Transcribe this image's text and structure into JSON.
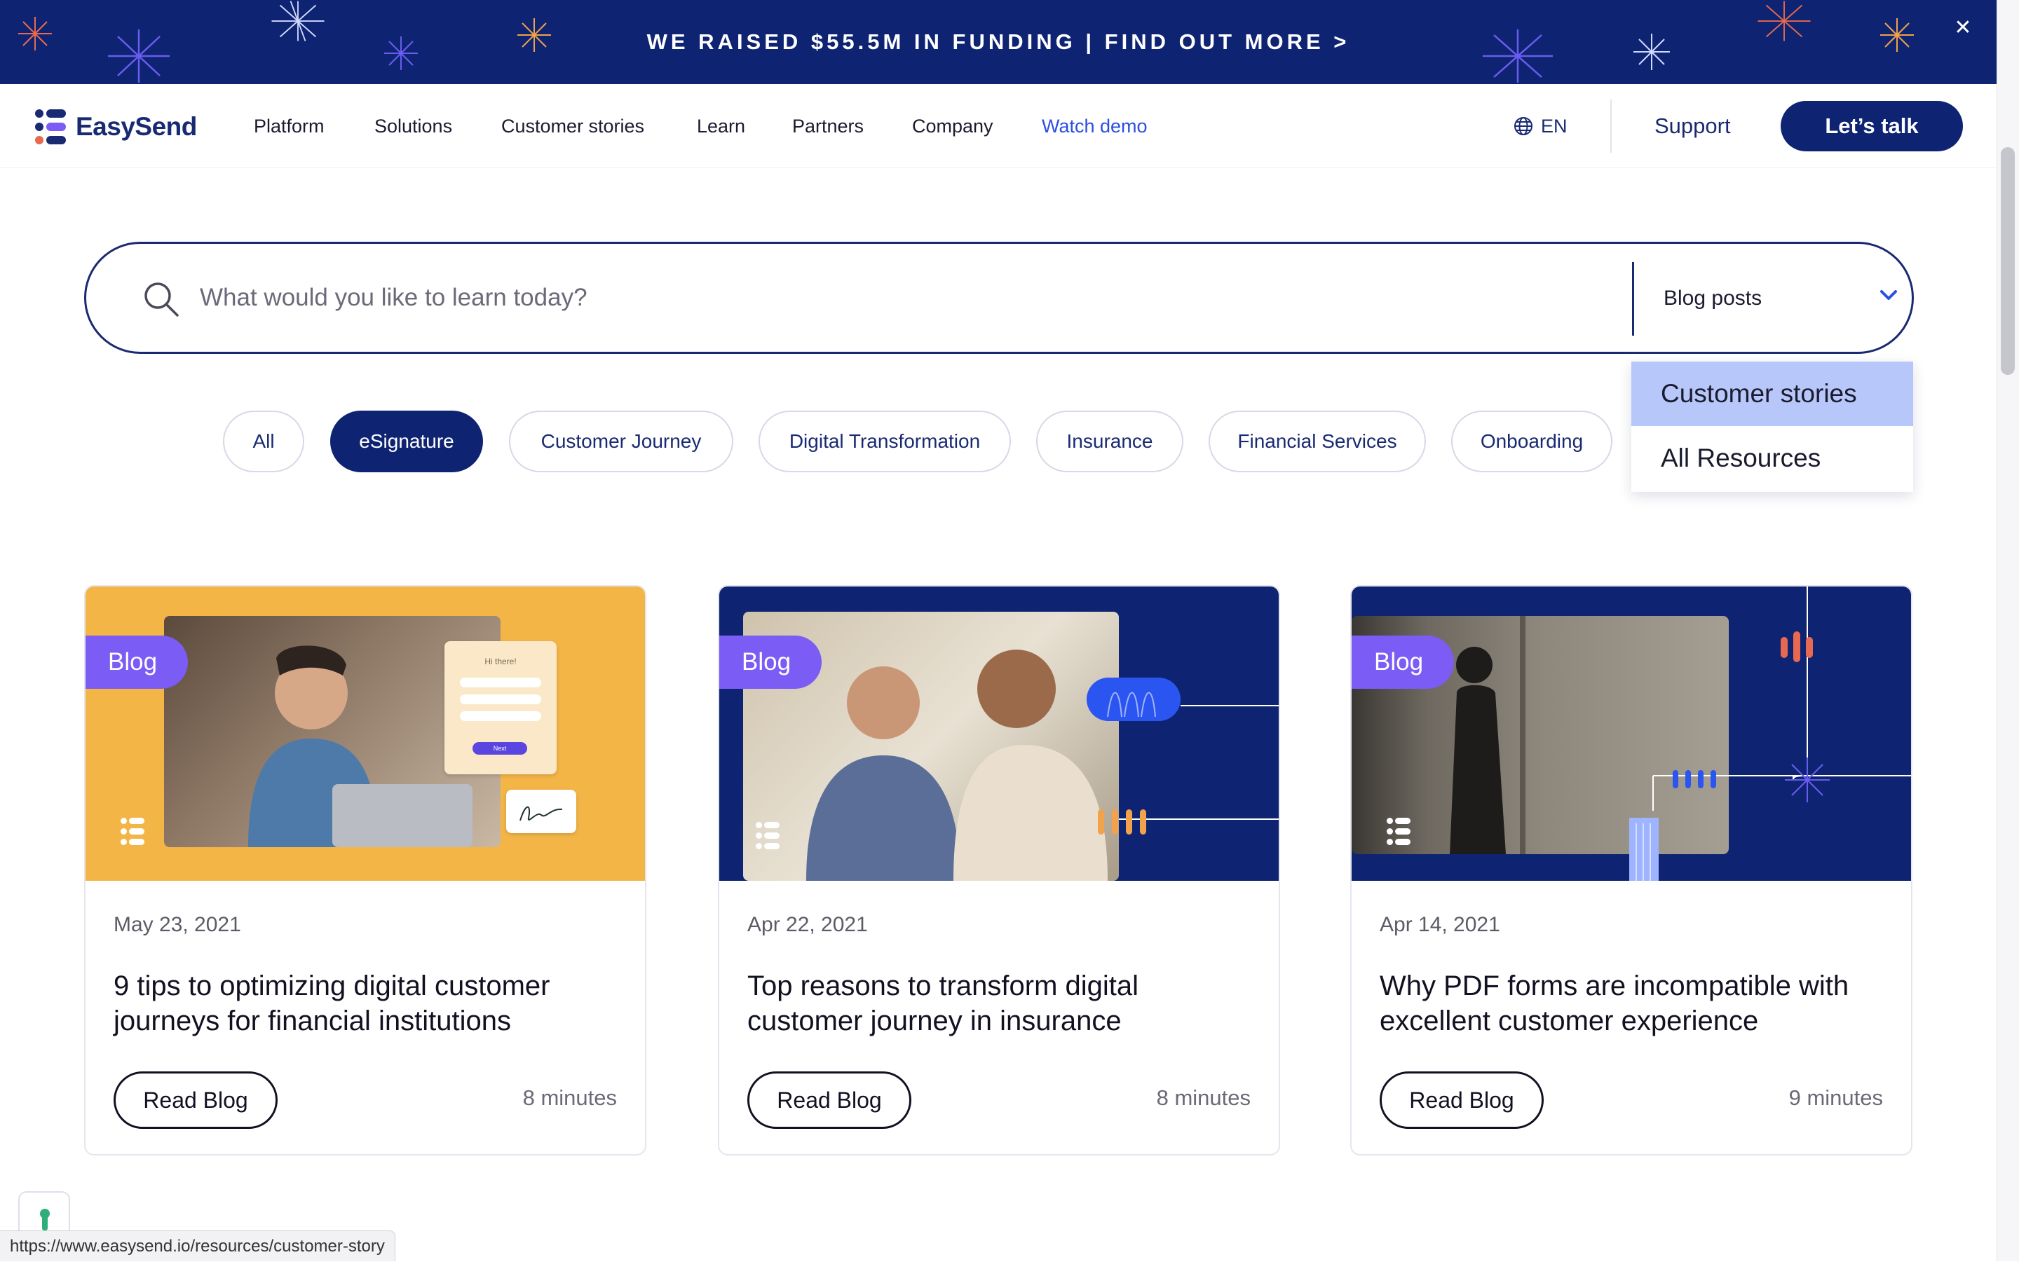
{
  "banner": {
    "text": "WE RAISED $55.5M IN FUNDING | FIND OUT MORE >",
    "close_icon": "close-icon"
  },
  "nav": {
    "logo": "EasySend",
    "items": [
      "Platform",
      "Solutions",
      "Customer stories",
      "Learn",
      "Partners",
      "Company"
    ],
    "watch_demo": "Watch demo",
    "language": "EN",
    "support": "Support",
    "cta": "Let’s talk"
  },
  "search": {
    "placeholder": "What would you like to learn today?",
    "value": "",
    "type_selected": "Blog posts"
  },
  "dropdown": {
    "options": [
      "Customer stories",
      "All Resources"
    ],
    "highlighted": "Customer stories"
  },
  "filters": {
    "chips": [
      "All",
      "eSignature",
      "Customer Journey",
      "Digital Transformation",
      "Insurance",
      "Financial Services",
      "Onboarding"
    ],
    "active": "eSignature"
  },
  "cards": [
    {
      "tag": "Blog",
      "date": "May 23, 2021",
      "title": "9 tips to optimizing digital customer journeys for financial institutions",
      "button": "Read Blog",
      "read_time": "8 minutes"
    },
    {
      "tag": "Blog",
      "date": "Apr 22, 2021",
      "title": "Top reasons to transform digital customer journey in insurance",
      "button": "Read Blog",
      "read_time": "8 minutes"
    },
    {
      "tag": "Blog",
      "date": "Apr 14, 2021",
      "title": "Why PDF forms are incompatible with excellent customer experience",
      "button": "Read Blog",
      "read_time": "9 minutes"
    }
  ],
  "card1_form": {
    "greeting": "Hi there!",
    "button": "Next"
  },
  "status_bar": {
    "url": "https://www.easysend.io/resources/customer-story"
  },
  "colors": {
    "brand_navy": "#0e2472",
    "link_blue": "#2b4fe0",
    "tag_purple": "#7b5cf5",
    "card1_bg": "#f4b547",
    "dropdown_highlight": "#b7c7f9"
  }
}
